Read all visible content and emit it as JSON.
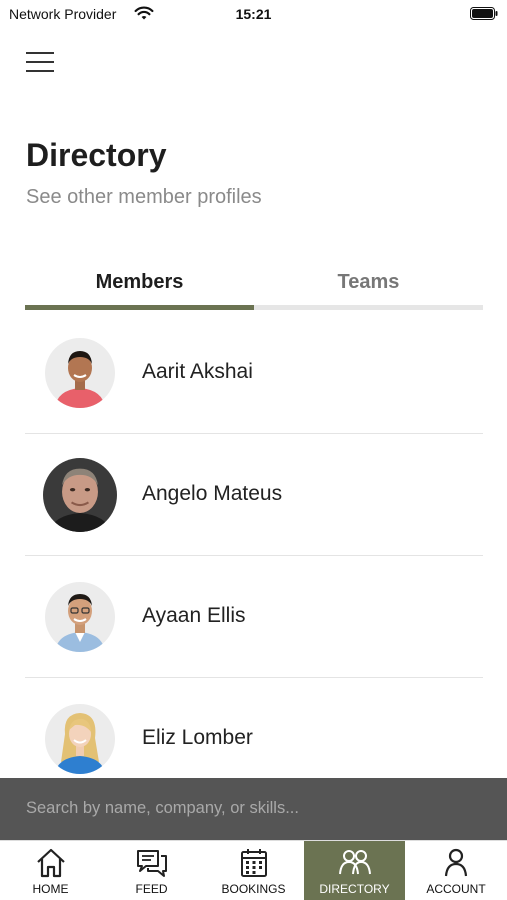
{
  "status_bar": {
    "carrier": "Network Provider",
    "time": "15:21"
  },
  "header": {
    "title": "Directory",
    "subtitle": "See other member profiles"
  },
  "tabs": {
    "members_label": "Members",
    "teams_label": "Teams",
    "active": "members"
  },
  "members": [
    {
      "name": "Aarit Akshai"
    },
    {
      "name": "Angelo Mateus"
    },
    {
      "name": "Ayaan Ellis"
    },
    {
      "name": "Eliz Lomber"
    }
  ],
  "search": {
    "placeholder": "Search by name, company, or skills..."
  },
  "bottom_nav": {
    "items": [
      {
        "label": "HOME",
        "icon": "home-icon"
      },
      {
        "label": "FEED",
        "icon": "feed-icon"
      },
      {
        "label": "BOOKINGS",
        "icon": "calendar-icon"
      },
      {
        "label": "DIRECTORY",
        "icon": "people-icon"
      },
      {
        "label": "ACCOUNT",
        "icon": "person-icon"
      }
    ],
    "active": "DIRECTORY"
  },
  "colors": {
    "accent": "#6b7352",
    "search_bar": "#555555"
  }
}
